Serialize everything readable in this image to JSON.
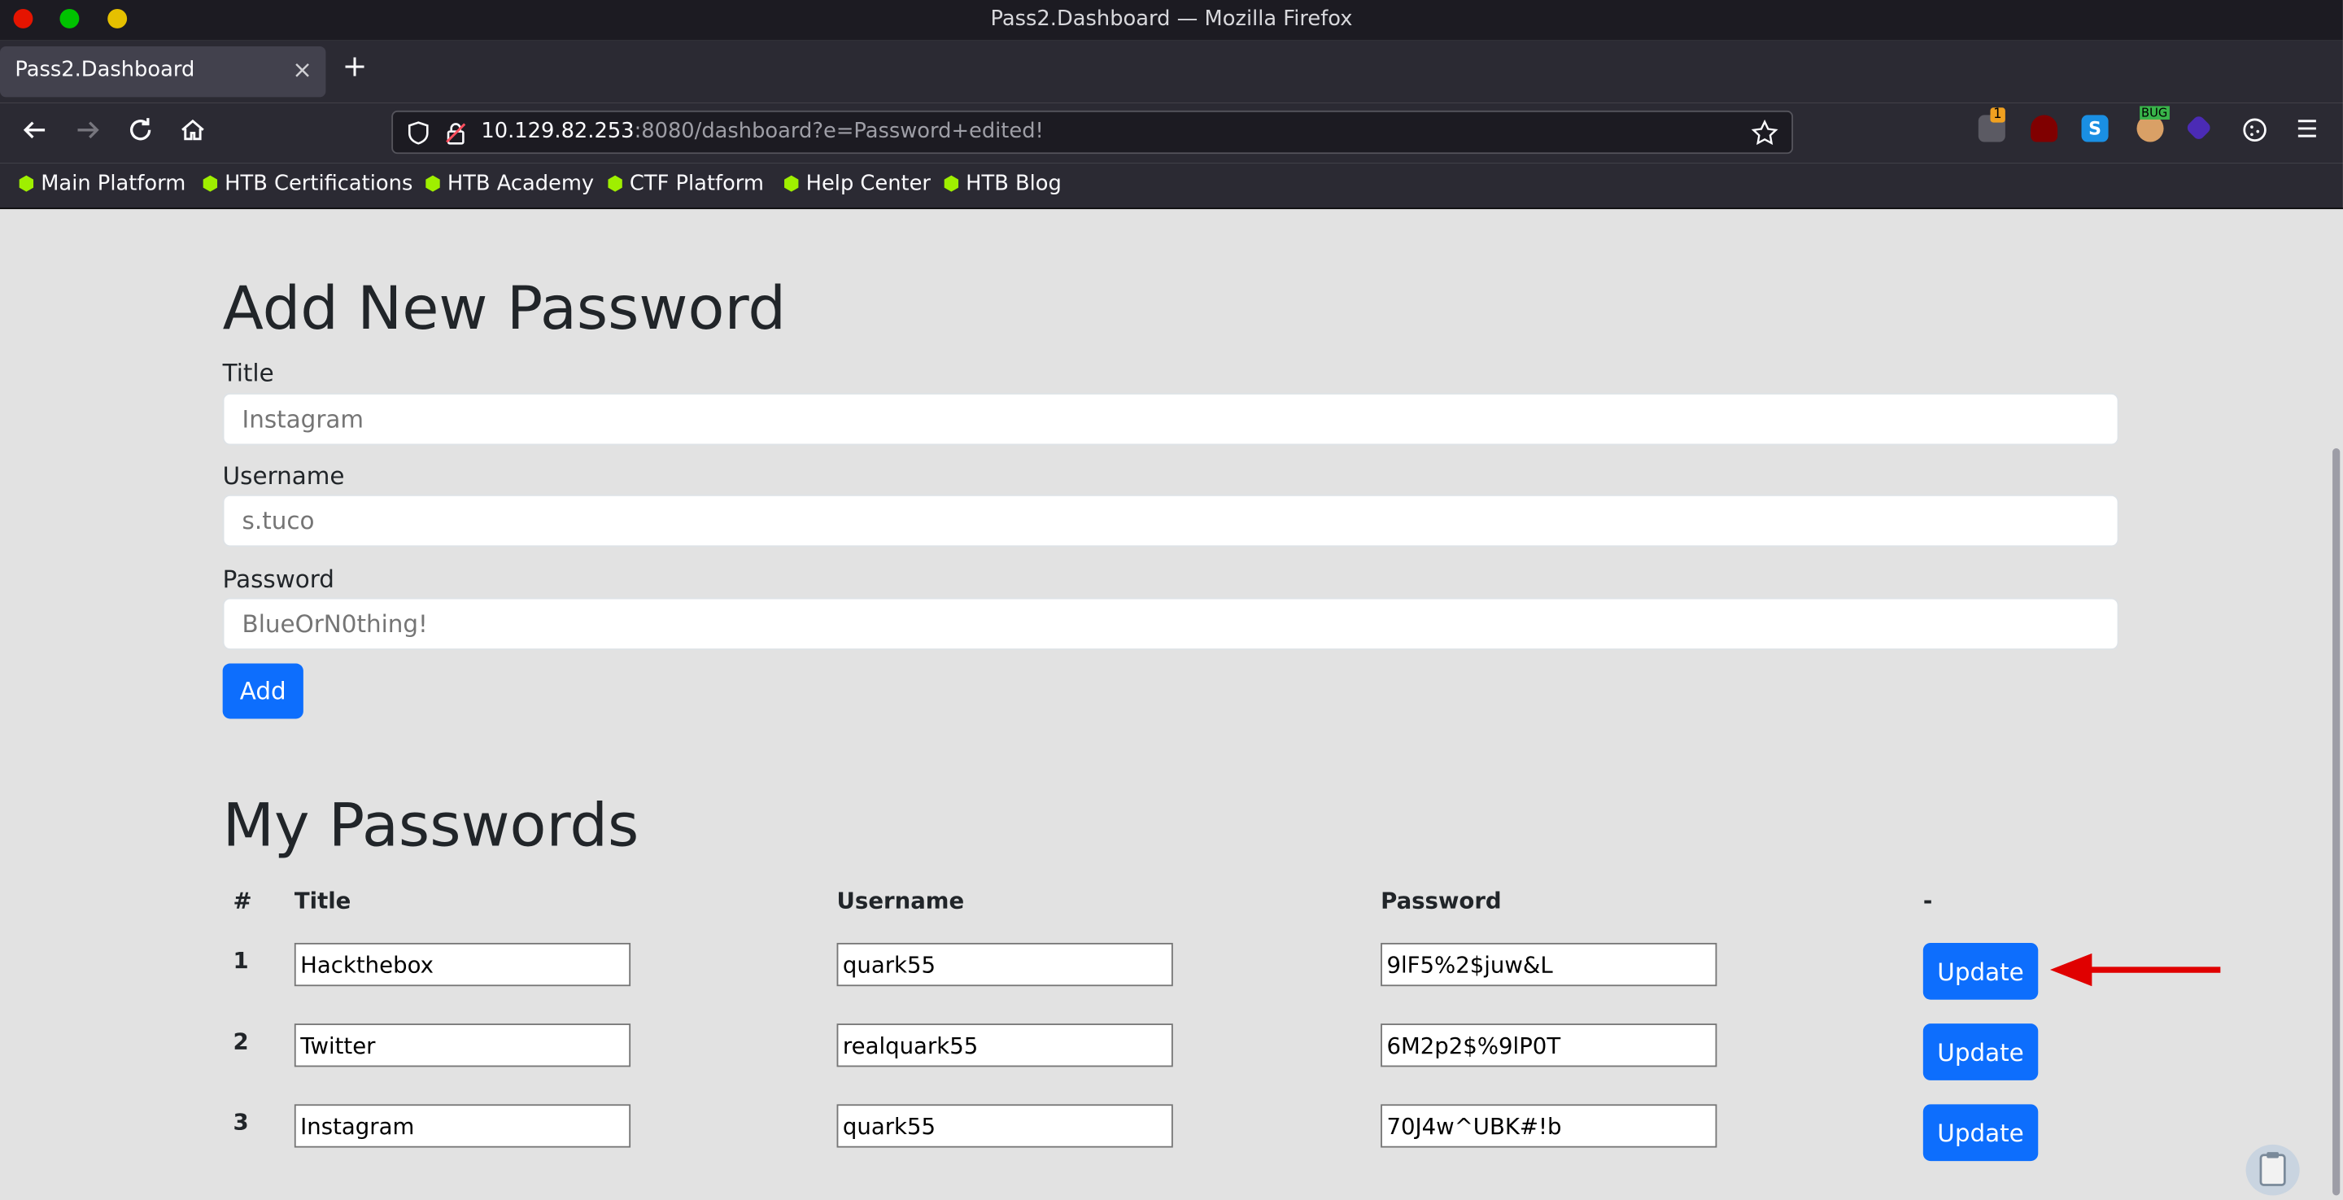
{
  "window": {
    "title": "Pass2.Dashboard — Mozilla Firefox"
  },
  "tabs": [
    {
      "label": "Pass2.Dashboard",
      "close": "×"
    }
  ],
  "new_tab": "+",
  "navbar": {
    "url_host": "10.129.82.253",
    "url_path": ":8080/dashboard?e=Password+edited!",
    "icons": [
      "back-icon",
      "forward-icon",
      "reload-icon",
      "home-icon",
      "shield-icon",
      "lock-icon",
      "star-icon",
      "extension-badge-icon",
      "ublock-icon",
      "s-extension-icon",
      "bug-extension-icon",
      "purple-extension-icon",
      "cookie-icon",
      "menu-icon"
    ],
    "badge_count": "1",
    "bug_label": "BUG"
  },
  "bookmarks": [
    {
      "label": "Main Platform"
    },
    {
      "label": "HTB Certifications"
    },
    {
      "label": "HTB Academy"
    },
    {
      "label": "CTF Platform"
    },
    {
      "label": "Help Center"
    },
    {
      "label": "HTB Blog"
    }
  ],
  "add_form": {
    "heading": "Add New Password",
    "title_label": "Title",
    "title_placeholder": "Instagram",
    "username_label": "Username",
    "username_placeholder": "s.tuco",
    "password_label": "Password",
    "password_placeholder": "BlueOrN0thing!",
    "add_button": "Add"
  },
  "passwords": {
    "heading": "My Passwords",
    "columns": [
      "#",
      "Title",
      "Username",
      "Password",
      "-"
    ],
    "rows": [
      {
        "num": "1",
        "title": "Hackthebox",
        "username": "quark55",
        "password": "9lF5%2$juw&L",
        "action": "Update"
      },
      {
        "num": "2",
        "title": "Twitter",
        "username": "realquark55",
        "password": "6M2p2$%9lP0T",
        "action": "Update"
      },
      {
        "num": "3",
        "title": "Instagram",
        "username": "quark55",
        "password": "70J4w^UBK#!b",
        "action": "Update"
      }
    ]
  },
  "colors": {
    "primary_button": "#0d6efd",
    "arrow": "#e00000",
    "page_bg": "#e2e2e2",
    "chrome_bg": "#2b2a33"
  }
}
